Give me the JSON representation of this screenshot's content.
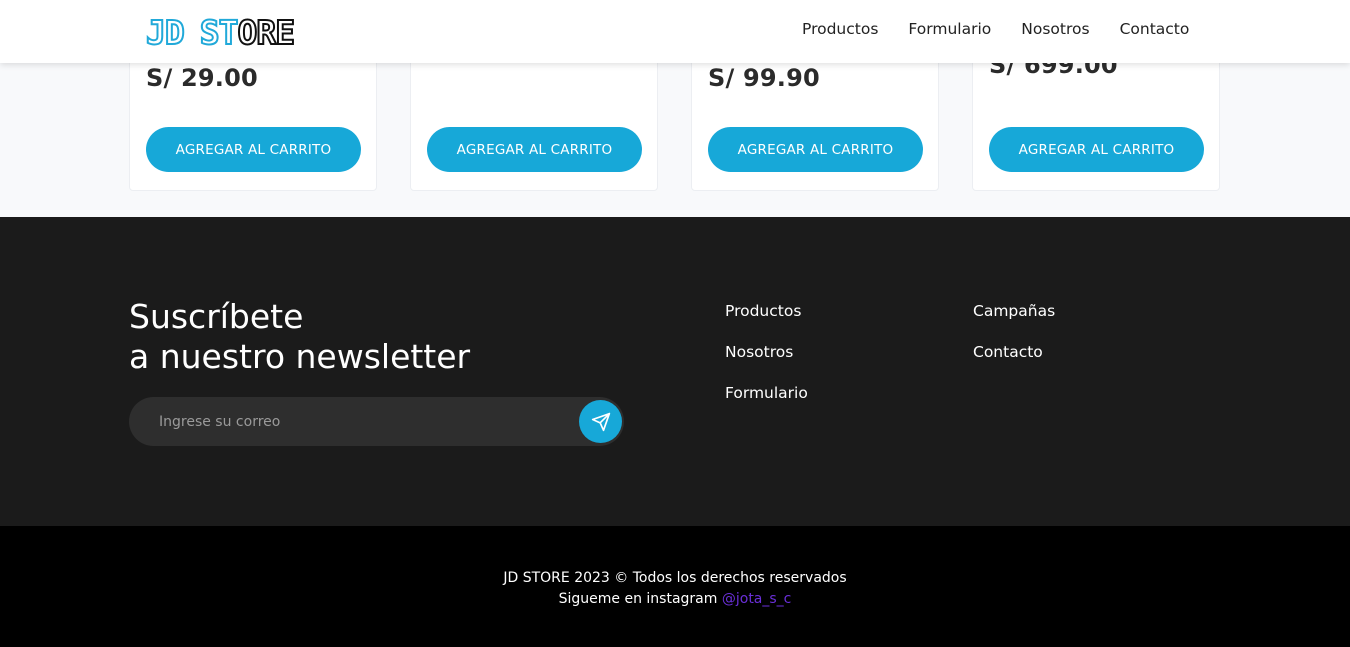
{
  "header": {
    "logo_part1": "JD",
    "logo_part2": "ST",
    "logo_part3": "ORE",
    "nav": [
      "Productos",
      "Formulario",
      "Nosotros",
      "Contacto"
    ]
  },
  "products": [
    {
      "price": "S/ 29.00",
      "button": "AGREGAR AL CARRITO"
    },
    {
      "price": "",
      "button": "AGREGAR AL CARRITO"
    },
    {
      "price": "S/ 99.90",
      "button": "AGREGAR AL CARRITO"
    },
    {
      "price": "S/ 699.00",
      "button": "AGREGAR AL CARRITO"
    }
  ],
  "newsletter": {
    "title_line1": "Suscríbete",
    "title_line2": "a nuestro newsletter",
    "placeholder": "Ingrese su correo",
    "send_icon": "paper-plane-icon"
  },
  "footer_links": {
    "col1": [
      "Productos",
      "Nosotros",
      "Formulario"
    ],
    "col2": [
      "Campañas",
      "Contacto"
    ]
  },
  "bottom": {
    "copyright": "JD STORE 2023 © Todos los derechos reservados",
    "instagram_prefix": "Sigueme en instagram",
    "instagram_handle": "@jota_s_c"
  },
  "colors": {
    "accent": "#17a8d8",
    "footer_top": "#1b1b1b",
    "footer_bottom": "#000000",
    "instagram": "#6a2fd8"
  }
}
